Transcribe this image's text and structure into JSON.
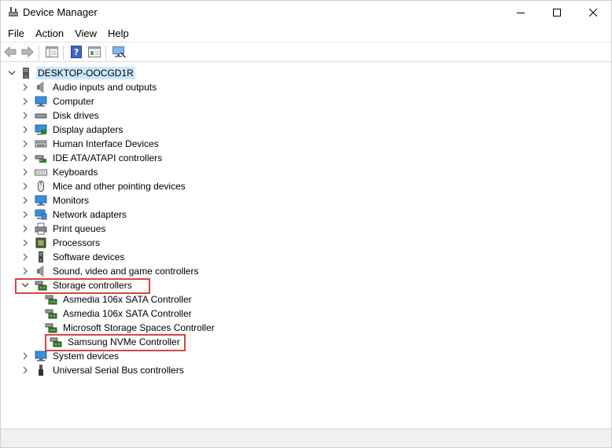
{
  "window": {
    "title": "Device Manager"
  },
  "menu": {
    "file": "File",
    "action": "Action",
    "view": "View",
    "help": "Help"
  },
  "tree": {
    "root": "DESKTOP-OOCGD1R",
    "categories": [
      "Audio inputs and outputs",
      "Computer",
      "Disk drives",
      "Display adapters",
      "Human Interface Devices",
      "IDE ATA/ATAPI controllers",
      "Keyboards",
      "Mice and other pointing devices",
      "Monitors",
      "Network adapters",
      "Print queues",
      "Processors",
      "Software devices",
      "Sound, video and game controllers",
      "Storage controllers",
      "System devices",
      "Universal Serial Bus controllers"
    ],
    "storage_children": [
      "Asmedia 106x SATA Controller",
      "Asmedia 106x SATA Controller",
      "Microsoft Storage Spaces Controller",
      "Samsung NVMe Controller"
    ]
  },
  "colors": {
    "highlight_border": "#d64541",
    "root_selection": "#cce8ff"
  }
}
